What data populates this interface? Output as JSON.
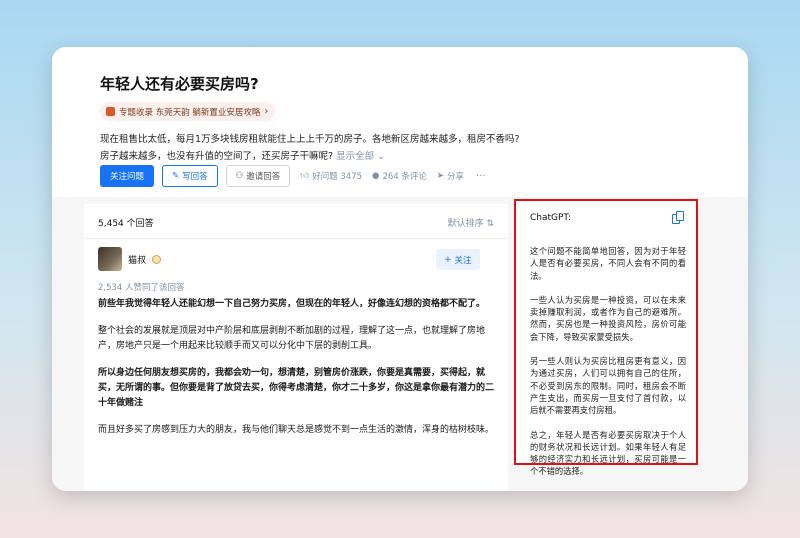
{
  "question": {
    "title": "年轻人还有必要买房吗?",
    "topic_tag": "专题收录 东莞天韵 躺新置业安居攻略",
    "description": "现在租售比太低，每月1万多块钱房租就能住上上上千万的房子。各地新区房越来越多，租房不香吗?房子越来越多，也没有升值的空间了，还买房子干嘛呢?",
    "show_all": "显示全部"
  },
  "actions": {
    "follow": "关注问题",
    "write": "写回答",
    "invite": "邀请回答",
    "good_question": "好问题 3475",
    "comments": "264 条评论",
    "share": "分享",
    "more": "···"
  },
  "answers": {
    "count": "5,454 个回答",
    "sort": "默认排序",
    "author": "猫叔",
    "follow": "关注",
    "agree": "2,534 人赞同了该回答",
    "paragraphs": [
      "前些年我觉得年轻人还能幻想一下自己努力买房，但现在的年轻人，好像连幻想的资格都不配了。",
      "整个社会的发展就是顶层对中产阶层和底层剥削不断加剧的过程，理解了这一点，也就理解了房地产，房地产只是一个用起来比较顺手而又可以分化中下层的剥削工具。",
      "所以身边任何朋友想买房的，我都会劝一句，想清楚，别管房价涨跌，你要是真需要，买得起，就买，无所谓的事。但你要是背了放贷去买，你得考虑清楚，你才二十多岁，你这是拿你最有潜力的二十年做赌注",
      "而且好多买了房感到压力大的朋友，我与他们聊天总是感觉不到一点生活的激情，浑身的枯树枝味。"
    ]
  },
  "chatgpt": {
    "title": "ChatGPT:",
    "paragraphs": [
      "这个问题不能简单地回答，因为对于年轻人是否有必要买房，不同人会有不同的看法。",
      "一些人认为买房是一种投资，可以在未来卖掉赚取利润，或者作为自己的避难所。然而，买房也是一种投资风险，房价可能会下降，导致买家蒙受损失。",
      "另一些人则认为买房比租房更有意义，因为通过买房，人们可以拥有自己的住所，不必受到房东的限制。同时，租房会不断产生支出，而买房一旦支付了首付款，以后就不需要再支付房租。",
      "总之，年轻人是否有必要买房取决于个人的财务状况和长远计划。如果年轻人有足够的经济实力和长远计划，买房可能是一个不错的选择。"
    ]
  },
  "colors": {
    "accent": "#1772f6",
    "highlight_border": "#d8131b",
    "muted": "#8590a6"
  }
}
